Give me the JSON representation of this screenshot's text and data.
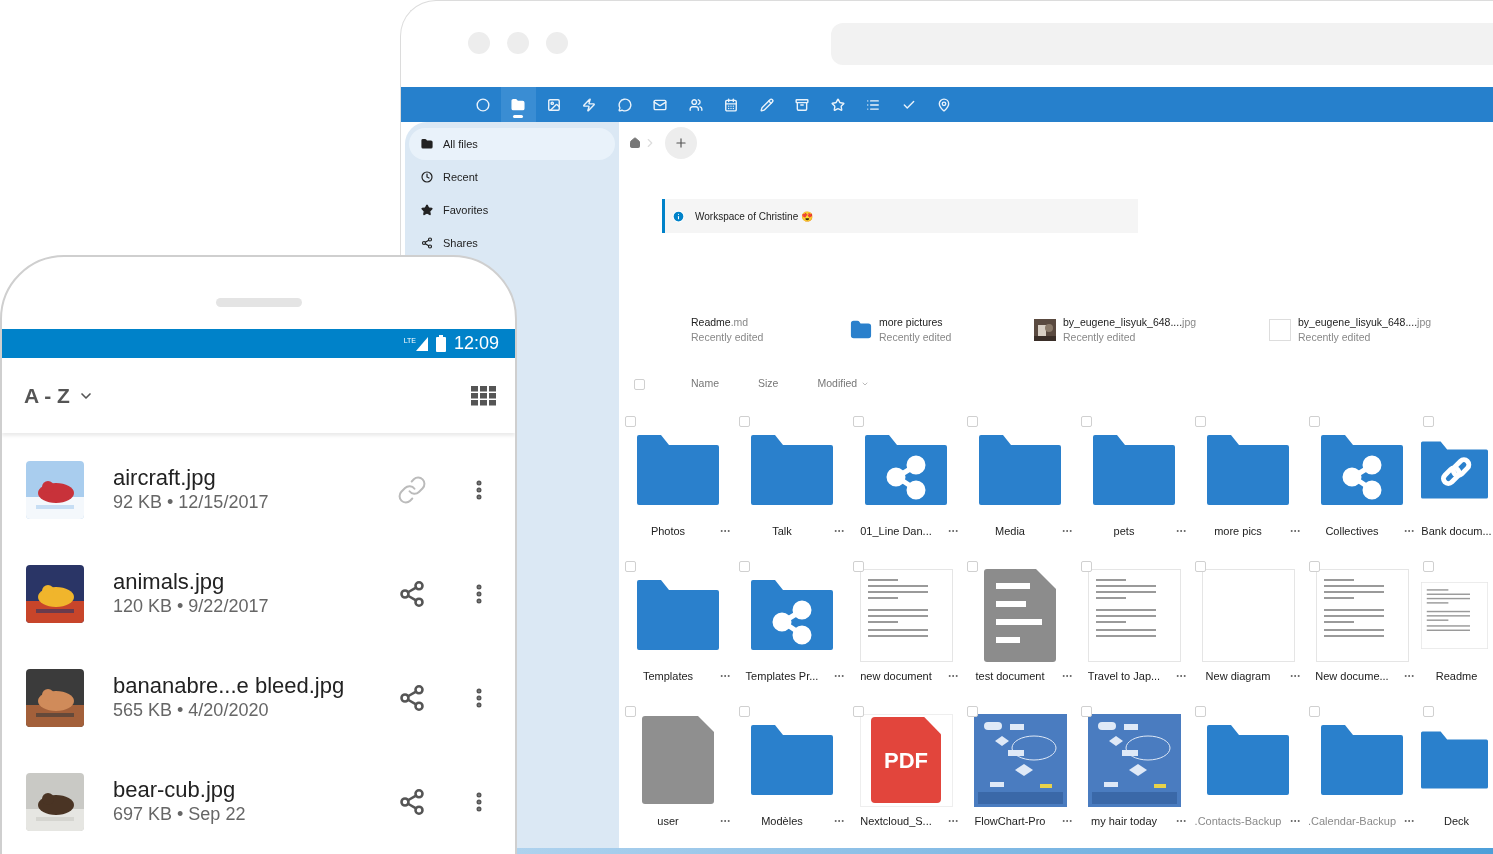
{
  "browser": {
    "app_bar": [
      {
        "selected": false
      },
      {
        "selected": true
      },
      {
        "selected": false
      },
      {
        "selected": false
      },
      {
        "selected": false
      },
      {
        "selected": false
      },
      {
        "selected": false
      },
      {
        "selected": false
      },
      {
        "selected": false
      },
      {
        "selected": false
      },
      {
        "selected": false
      },
      {
        "selected": false
      },
      {
        "selected": false
      },
      {
        "selected": false
      }
    ],
    "sidebar": {
      "items": [
        {
          "label": "All files",
          "kind": "files",
          "selected": true
        },
        {
          "label": "Recent",
          "kind": "recent",
          "selected": false
        },
        {
          "label": "Favorites",
          "kind": "favorites",
          "selected": false
        },
        {
          "label": "Shares",
          "kind": "shares",
          "selected": false
        }
      ]
    },
    "info_box": {
      "text": "Workspace of Christine 😍"
    },
    "recent": [
      {
        "name": "Readme",
        "ext": ".md",
        "subtitle": "Recently edited",
        "kind": "none"
      },
      {
        "name": "more pictures",
        "subtitle": "Recently edited",
        "kind": "folder"
      },
      {
        "name": "by_eugene_lisyuk_648....",
        "ext": "jpg",
        "subtitle": "Recently edited",
        "kind": "picture"
      },
      {
        "name": "by_eugene_lisyuk_648....",
        "ext": "jpg",
        "subtitle": "Recently edited",
        "kind": "blank"
      }
    ],
    "list_header": {
      "checked": false,
      "columns": [
        "Name",
        "Size",
        "Modified"
      ]
    },
    "files": [
      {
        "name": "Photos",
        "kind": "folder",
        "checked": false,
        "dimmed": false
      },
      {
        "name": "Talk",
        "kind": "folder",
        "checked": false,
        "dimmed": false
      },
      {
        "name": "01_Line Dan...",
        "kind": "shared-folder",
        "checked": false,
        "dimmed": false
      },
      {
        "name": "Media",
        "kind": "folder",
        "checked": false,
        "dimmed": false
      },
      {
        "name": "pets",
        "kind": "folder",
        "checked": false,
        "dimmed": false
      },
      {
        "name": "more pics",
        "kind": "folder",
        "checked": false,
        "dimmed": false
      },
      {
        "name": "Collectives",
        "kind": "shared-folder",
        "checked": false,
        "dimmed": false
      },
      {
        "name": "Bank docum...",
        "kind": "link-folder",
        "checked": false,
        "dimmed": false
      },
      {
        "name": "Templates",
        "kind": "folder",
        "checked": false,
        "dimmed": false
      },
      {
        "name": "Templates Pr...",
        "kind": "shared-folder",
        "checked": false,
        "dimmed": false
      },
      {
        "name": "new document",
        "kind": "document-preview",
        "checked": false,
        "dimmed": false
      },
      {
        "name": "test document",
        "kind": "text-file",
        "checked": false,
        "dimmed": false
      },
      {
        "name": "Travel to Jap...",
        "kind": "document-preview",
        "checked": false,
        "dimmed": false
      },
      {
        "name": "New diagram",
        "kind": "blank-preview",
        "checked": false,
        "dimmed": false
      },
      {
        "name": "New docume...",
        "kind": "document-preview",
        "checked": false,
        "dimmed": false
      },
      {
        "name": "Readme",
        "kind": "document-preview",
        "checked": false,
        "dimmed": false
      },
      {
        "name": "user",
        "kind": "generic-file",
        "checked": false,
        "dimmed": false
      },
      {
        "name": "Modèles",
        "kind": "folder",
        "checked": false,
        "dimmed": false
      },
      {
        "name": "Nextcloud_S...",
        "kind": "pdf",
        "icon_text": "PDF",
        "checked": false,
        "dimmed": false
      },
      {
        "name": "FlowChart-Pro",
        "kind": "picture",
        "checked": false,
        "dimmed": false
      },
      {
        "name": "my hair today",
        "kind": "picture",
        "checked": false,
        "dimmed": false
      },
      {
        "name": ".Contacts-Backup",
        "kind": "folder",
        "checked": false,
        "dimmed": true
      },
      {
        "name": ".Calendar-Backup",
        "kind": "folder",
        "checked": false,
        "dimmed": true
      },
      {
        "name": "Deck",
        "kind": "folder",
        "checked": false,
        "dimmed": false
      }
    ]
  },
  "phone": {
    "status_bar": {
      "network": "LTE",
      "time": "12:09"
    },
    "sort": "A - Z",
    "files": [
      {
        "name": "aircraft.jpg",
        "meta": "92 KB • 12/15/2017",
        "kind": "link"
      },
      {
        "name": "animals.jpg",
        "meta": "120 KB • 9/22/2017",
        "kind": "share"
      },
      {
        "name": "bananabre...e bleed.jpg",
        "meta": "565 KB • 4/20/2020",
        "kind": "share"
      },
      {
        "name": "bear-cub.jpg",
        "meta": "697 KB • Sep 22",
        "kind": "share"
      }
    ]
  }
}
